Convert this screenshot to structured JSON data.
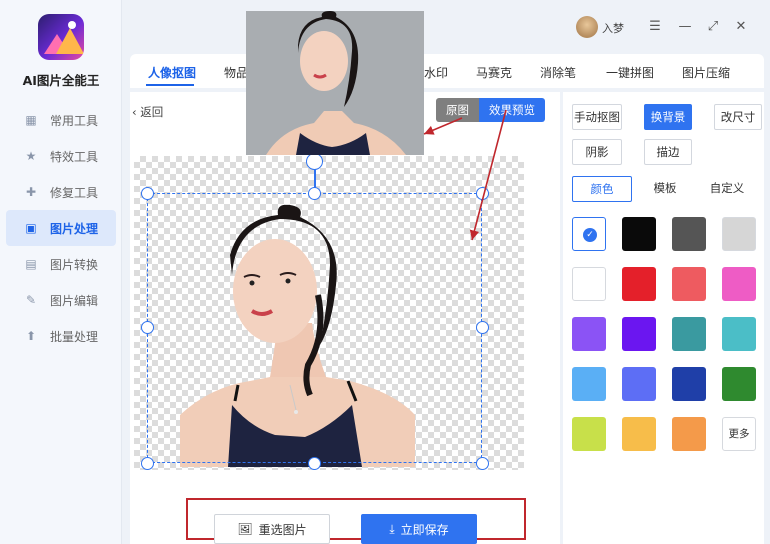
{
  "app": {
    "title": "AI图片全能王"
  },
  "sidebar": {
    "items": [
      {
        "label": "常用工具",
        "icon": "grid-icon"
      },
      {
        "label": "特效工具",
        "icon": "star-icon"
      },
      {
        "label": "修复工具",
        "icon": "bandage-icon"
      },
      {
        "label": "图片处理",
        "icon": "image-process-icon",
        "active": true
      },
      {
        "label": "图片转换",
        "icon": "convert-icon"
      },
      {
        "label": "图片编辑",
        "icon": "edit-icon"
      },
      {
        "label": "批量处理",
        "icon": "batch-icon"
      }
    ]
  },
  "topbar": {
    "user_name": "入梦",
    "menu_icon": "☰",
    "max_icon": "⤢",
    "close_icon": "✕"
  },
  "tabs": [
    "人像抠图",
    "物品",
    "水印",
    "马赛克",
    "消除笔",
    "一键拼图",
    "图片压缩"
  ],
  "editor": {
    "back_label": "返回",
    "toggle_original": "原图",
    "toggle_preview": "效果预览",
    "reselect_label": "重选图片",
    "save_label": "立即保存"
  },
  "right_panel": {
    "manual_cutout": "手动抠图",
    "change_bg": "换背景",
    "resize": "改尺寸",
    "shadow": "阴影",
    "stroke": "描边",
    "subtabs": [
      "颜色",
      "模板",
      "自定义"
    ],
    "more_label": "更多",
    "swatch_colors": [
      [
        "transparent",
        "#0a0a0a",
        "#555555",
        "#d6d6d6"
      ],
      [
        "#ffffff",
        "#e4202a",
        "#ee5b60",
        "#ee5cc5"
      ],
      [
        "#8b53f5",
        "#6b16f0",
        "#3a9aa0",
        "#4bbec7"
      ],
      [
        "#5aaff5",
        "#5d6ef5",
        "#1f3fa8",
        "#2f8a2f"
      ],
      [
        "#c8e04a",
        "#f7bd4a",
        "#f49a4a",
        "more"
      ]
    ]
  },
  "colors": {
    "accent": "#2f73f0",
    "highlight_box": "#c0272d"
  }
}
